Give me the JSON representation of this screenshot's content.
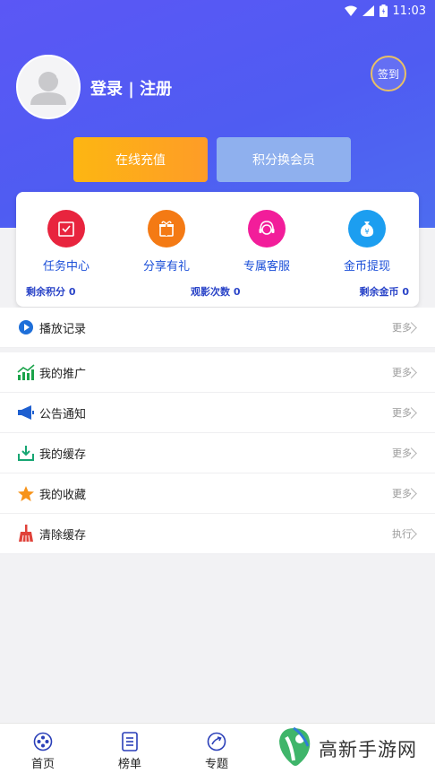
{
  "status_bar": {
    "time": "11:03",
    "icons": [
      "wifi-icon",
      "signal-icon",
      "battery-icon"
    ]
  },
  "header": {
    "login_label": "登录 | 注册",
    "signin_label": "签到",
    "recharge_label": "在线充值",
    "exchange_label": "积分换会员"
  },
  "features": [
    {
      "label": "任务中心",
      "icon": "task-icon",
      "color": "#e8243e"
    },
    {
      "label": "分享有礼",
      "icon": "gift-icon",
      "color": "#f47a14"
    },
    {
      "label": "专属客服",
      "icon": "service-icon",
      "color": "#f21d9a"
    },
    {
      "label": "金币提现",
      "icon": "money-bag-icon",
      "color": "#1c9ef0"
    }
  ],
  "stats": {
    "points": "剩余积分 0",
    "views": "观影次数 0",
    "coins": "剩余金币 0"
  },
  "list": [
    {
      "label": "播放记录",
      "action": "更多",
      "icon": "play-icon"
    },
    {
      "label": "我的推广",
      "action": "更多",
      "icon": "chart-icon"
    },
    {
      "label": "公告通知",
      "action": "更多",
      "icon": "megaphone-icon"
    },
    {
      "label": "我的缓存",
      "action": "更多",
      "icon": "download-icon"
    },
    {
      "label": "我的收藏",
      "action": "更多",
      "icon": "star-icon"
    },
    {
      "label": "清除缓存",
      "action": "执行",
      "icon": "broom-icon"
    }
  ],
  "tabs": [
    {
      "label": "首页",
      "icon": "home-film-icon"
    },
    {
      "label": "榜单",
      "icon": "list-icon"
    },
    {
      "label": "专题",
      "icon": "topic-icon"
    }
  ],
  "watermark": {
    "text": "高新手游网"
  },
  "colors": {
    "header_start": "#5b57f5",
    "header_end": "#4d6cf0",
    "accent_blue": "#1b4fd8",
    "recharge": "#fdb612",
    "exchange": "#8fb0ee"
  }
}
